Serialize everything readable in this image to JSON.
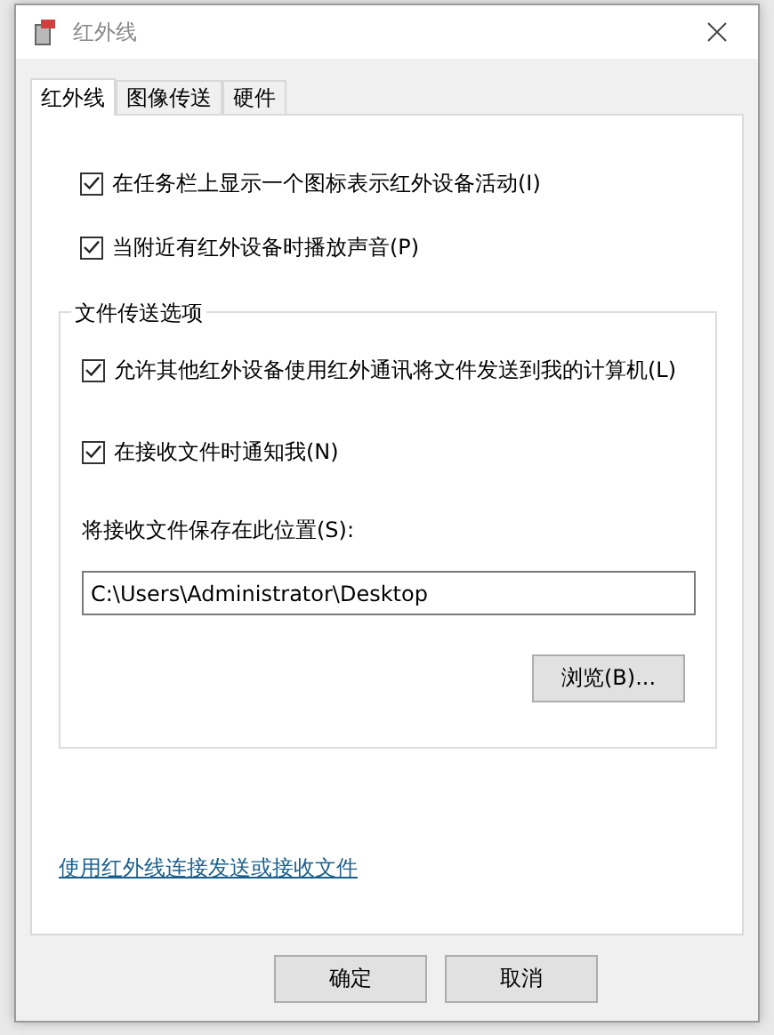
{
  "window": {
    "title": "红外线"
  },
  "tabs": [
    {
      "label": "红外线",
      "selected": true
    },
    {
      "label": "图像传送",
      "selected": false
    },
    {
      "label": "硬件",
      "selected": false
    }
  ],
  "options": [
    {
      "label": "在任务栏上显示一个图标表示红外设备活动(I)",
      "checked": true
    },
    {
      "label": "当附近有红外设备时播放声音(P)",
      "checked": true
    }
  ],
  "file_transfer": {
    "title": "文件传送选项",
    "options": [
      {
        "label": "允许其他红外设备使用红外通讯将文件发送到我的计算机(L)",
        "checked": true
      },
      {
        "label": "在接收文件时通知我(N)",
        "checked": true
      }
    ],
    "save_label": "将接收文件保存在此位置(S):",
    "save_path": "C:\\Users\\Administrator\\Desktop",
    "browse_button": "浏览(B)..."
  },
  "link": "使用红外线连接发送或接收文件",
  "buttons": [
    "确定",
    "取消"
  ]
}
